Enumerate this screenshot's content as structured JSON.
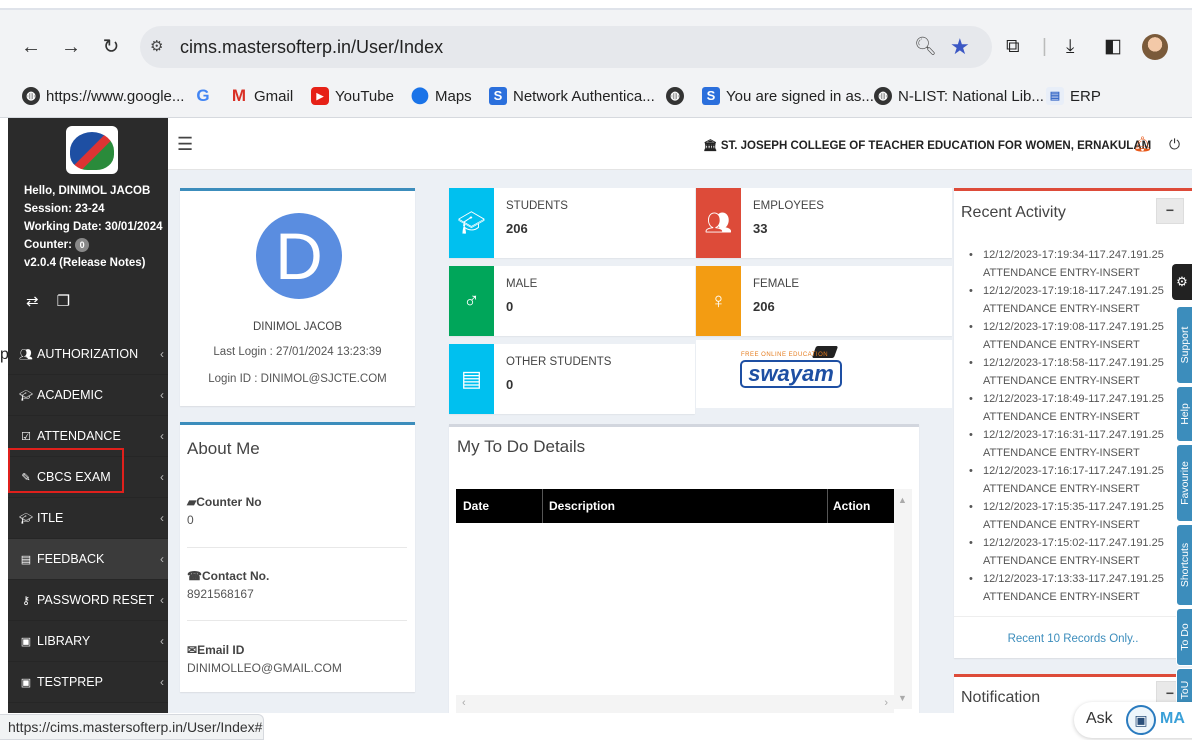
{
  "browser": {
    "url": "cims.mastersofterp.in/User/Index",
    "status_url": "https://cims.mastersofterp.in/User/Index#",
    "bookmarks": [
      {
        "label": "https://www.google...",
        "icon": "globe-icon"
      },
      {
        "label": "",
        "icon": "google-icon"
      },
      {
        "label": "Gmail",
        "icon": "gmail-icon"
      },
      {
        "label": "YouTube",
        "icon": "youtube-icon"
      },
      {
        "label": "Maps",
        "icon": "maps-icon"
      },
      {
        "label": "Network Authentica...",
        "icon": "s-icon"
      },
      {
        "label": "",
        "icon": "globe-icon"
      },
      {
        "label": "You are signed in as...",
        "icon": "s-icon"
      },
      {
        "label": "N-LIST: National Lib...",
        "icon": "globe-icon"
      },
      {
        "label": "ERP",
        "icon": "erp-icon"
      }
    ]
  },
  "sidebar": {
    "hello": "Hello, DINIMOL JACOB",
    "session": "Session: 23-24",
    "working_date": "Working Date: 30/01/2024",
    "counter_label": "Counter:",
    "counter_value": "0",
    "version": "v2.0.4 (Release Notes)",
    "stray_glyph": "p",
    "menu": [
      {
        "label": "AUTHORIZATION",
        "icon": "users-icon"
      },
      {
        "label": "ACADEMIC",
        "icon": "graduation-cap-icon"
      },
      {
        "label": "ATTENDANCE",
        "icon": "check-square-icon"
      },
      {
        "label": "CBCS EXAM",
        "icon": "edit-icon"
      },
      {
        "label": "ITLE",
        "icon": "graduation-cap-icon"
      },
      {
        "label": "FEEDBACK",
        "icon": "list-icon"
      },
      {
        "label": "PASSWORD RESET",
        "icon": "key-icon"
      },
      {
        "label": "LIBRARY",
        "icon": "book-icon"
      },
      {
        "label": "TESTPREP",
        "icon": "book-icon"
      }
    ]
  },
  "header": {
    "college": "ST. JOSEPH COLLEGE OF TEACHER EDUCATION FOR WOMEN, ERNAKULAM"
  },
  "profile": {
    "initial": "D",
    "name": "DINIMOL JACOB",
    "last_login": "Last Login : 27/01/2024 13:23:39",
    "login_id": "Login ID : DINIMOL@SJCTE.COM"
  },
  "about": {
    "title": "About Me",
    "counter_label": "Counter No",
    "counter_value": "0",
    "contact_label": "Contact No.",
    "contact_value": "8921568167",
    "email_label": "Email ID",
    "email_value": "DINIMOLLEO@GMAIL.COM"
  },
  "stats": [
    {
      "label": "STUDENTS",
      "value": "206",
      "color": "#00c0ef",
      "icon": "graduation-cap-icon"
    },
    {
      "label": "EMPLOYEES",
      "value": "33",
      "color": "#dd4b39",
      "icon": "users-icon"
    },
    {
      "label": "MALE",
      "value": "0",
      "color": "#00a65a",
      "icon": "male-icon"
    },
    {
      "label": "FEMALE",
      "value": "206",
      "color": "#f39c12",
      "icon": "female-icon"
    },
    {
      "label": "OTHER STUDENTS",
      "value": "0",
      "color": "#00c0ef",
      "icon": "book-icon"
    }
  ],
  "swayam": {
    "tagline": "FREE ONLINE EDUCATION",
    "word": "swayam"
  },
  "todo": {
    "title": "My To Do Details",
    "columns": [
      "Date",
      "Description",
      "Action"
    ]
  },
  "recent": {
    "title": "Recent Activity",
    "items": [
      "12/12/2023-17:19:34-117.247.191.25 ATTENDANCE ENTRY-INSERT",
      "12/12/2023-17:19:18-117.247.191.25 ATTENDANCE ENTRY-INSERT",
      "12/12/2023-17:19:08-117.247.191.25 ATTENDANCE ENTRY-INSERT",
      "12/12/2023-17:18:58-117.247.191.25 ATTENDANCE ENTRY-INSERT",
      "12/12/2023-17:18:49-117.247.191.25 ATTENDANCE ENTRY-INSERT",
      "12/12/2023-17:16:31-117.247.191.25 ATTENDANCE ENTRY-INSERT",
      "12/12/2023-17:16:17-117.247.191.25 ATTENDANCE ENTRY-INSERT",
      "12/12/2023-17:15:35-117.247.191.25 ATTENDANCE ENTRY-INSERT",
      "12/12/2023-17:15:02-117.247.191.25 ATTENDANCE ENTRY-INSERT",
      "12/12/2023-17:13:33-117.247.191.25 ATTENDANCE ENTRY-INSERT"
    ],
    "footer": "Recent 10 Records Only.."
  },
  "notification": {
    "title": "Notification"
  },
  "side_tabs": [
    "Support",
    "Help",
    "Favourite",
    "Shortcuts",
    "To Do",
    "ToU"
  ],
  "chat": {
    "ask": "Ask",
    "brand": "MA"
  },
  "buttons": {
    "collapse": "−"
  }
}
